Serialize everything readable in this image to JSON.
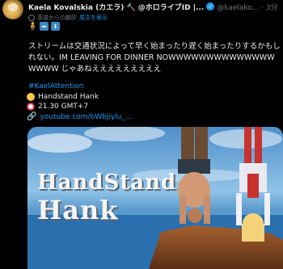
{
  "author": {
    "name": "Kaela Kovalskia (カエラ) 🔨 @ホロライブID |...",
    "handle": "@kaelako... · 3分"
  },
  "translation": {
    "label": "英語からの翻訳",
    "link": "原文を表示"
  },
  "emoji_line": [
    "person-standing",
    "right-arrow",
    "down-arrow"
  ],
  "tweet": {
    "text": "ストリームは交通状況によって早く始まったり遅く始まったりするかもしれない。IM LEAVING FOR DINNER NOWWWWWWWWWWWWWWWWWW じゃあねえええええええええ",
    "hashtag": "#KaelAttention",
    "line1": "Handstand Hank",
    "line2": "21.30 GMT+7",
    "url": "youtube.com/bWbjiylu_..."
  },
  "media": {
    "title_line1": "HandStand",
    "title_line2": "Hank"
  },
  "colors": {
    "accent": "#1d9bf0",
    "background": "#000000",
    "text": "#e7e9ea",
    "muted": "#71767b"
  }
}
